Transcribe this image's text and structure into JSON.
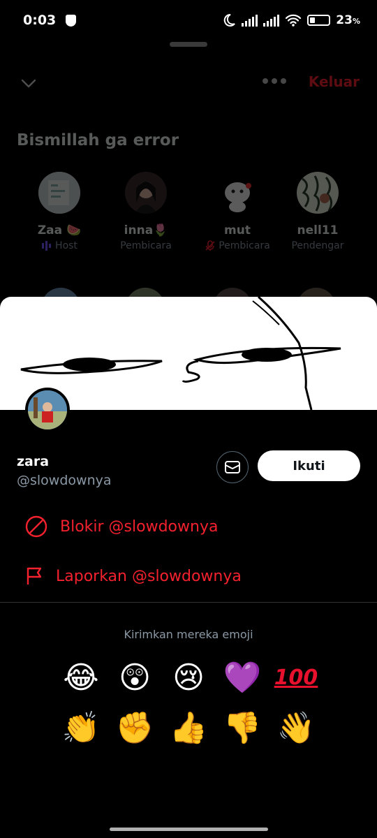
{
  "status_bar": {
    "time": "0:03",
    "battery": "23",
    "battery_unit": "%"
  },
  "space": {
    "title": "Bismillah ga error",
    "exit_label": "Keluar",
    "participants": [
      {
        "name": "Zaa 🍉",
        "role": "Host"
      },
      {
        "name": "inna🌷",
        "role": "Pembicara"
      },
      {
        "name": "mut",
        "role": "Pembicara"
      },
      {
        "name": "nell11",
        "role": "Pendengar"
      }
    ]
  },
  "profile": {
    "name": "zara",
    "handle": "@slowdownya",
    "follow_label": "Ikuti",
    "block_label": "Blokir @slowdownya",
    "report_label": "Laporkan @slowdownya"
  },
  "emoji": {
    "label": "Kirimkan mereka emoji",
    "row1": [
      "😂",
      "😲",
      "😢",
      "💜",
      "100"
    ],
    "row2": [
      "👏",
      "✊",
      "👍",
      "👎",
      "👋"
    ]
  },
  "colors": {
    "danger": "#f4212e",
    "host_purple": "#7856ff",
    "muted": "#8b98a5"
  }
}
